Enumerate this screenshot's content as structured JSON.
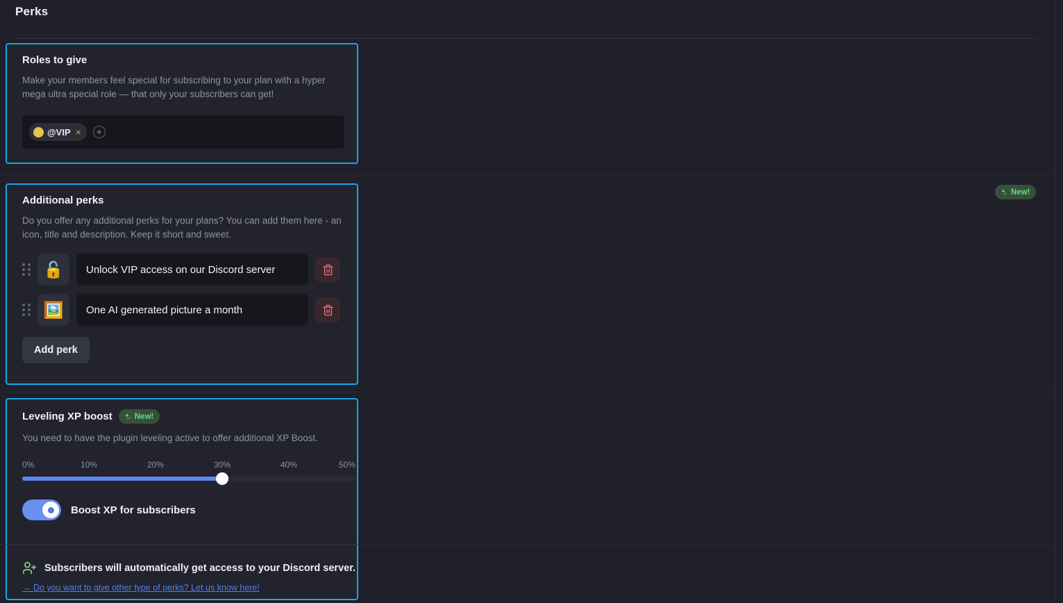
{
  "header": {
    "title": "Perks"
  },
  "cards": {
    "roles": {
      "title": "Roles to give",
      "description": "Make your members feel special for subscribing to your plan with a hyper mega ultra special role — that only your subscribers can get!",
      "chip": {
        "name": "@VIP",
        "remove": "×",
        "color": "#e8c252"
      },
      "add_role": "+"
    },
    "additional": {
      "title": "Additional perks",
      "description": "Do you offer any additional perks for your plans? You can add them here - an icon, title and description. Keep it short and sweet.",
      "badge": "New!",
      "perks": [
        {
          "icon": "🔓",
          "icon_name": "unlock-emoji",
          "title": "Unlock VIP access on our Discord server"
        },
        {
          "icon": "🖼️",
          "icon_name": "framed-picture-emoji",
          "title": "One AI generated picture a month"
        }
      ],
      "add_button": "Add perk"
    },
    "leveling": {
      "title": "Leveling XP boost",
      "badge": "New!",
      "description": "You need to have the plugin leveling active to offer additional XP Boost.",
      "slider": {
        "ticks": [
          "0%",
          "10%",
          "20%",
          "30%",
          "40%",
          "50%"
        ],
        "min": 0,
        "max": 50,
        "value": 30,
        "fill_color": "#5b87ee"
      },
      "toggle": {
        "label": "Boost XP for subscribers",
        "state": "on"
      },
      "footer_note": "Subscribers will automatically get access to your Discord server.",
      "footer_link": "→ Do you want to give other type of perks? Let us know here!"
    }
  },
  "colors": {
    "accent": "#19a7e8",
    "background": "#1f2029",
    "card": "#22232d",
    "field": "#16171d",
    "badge_green": "#68d98a",
    "link_blue": "#4c7ef3"
  }
}
